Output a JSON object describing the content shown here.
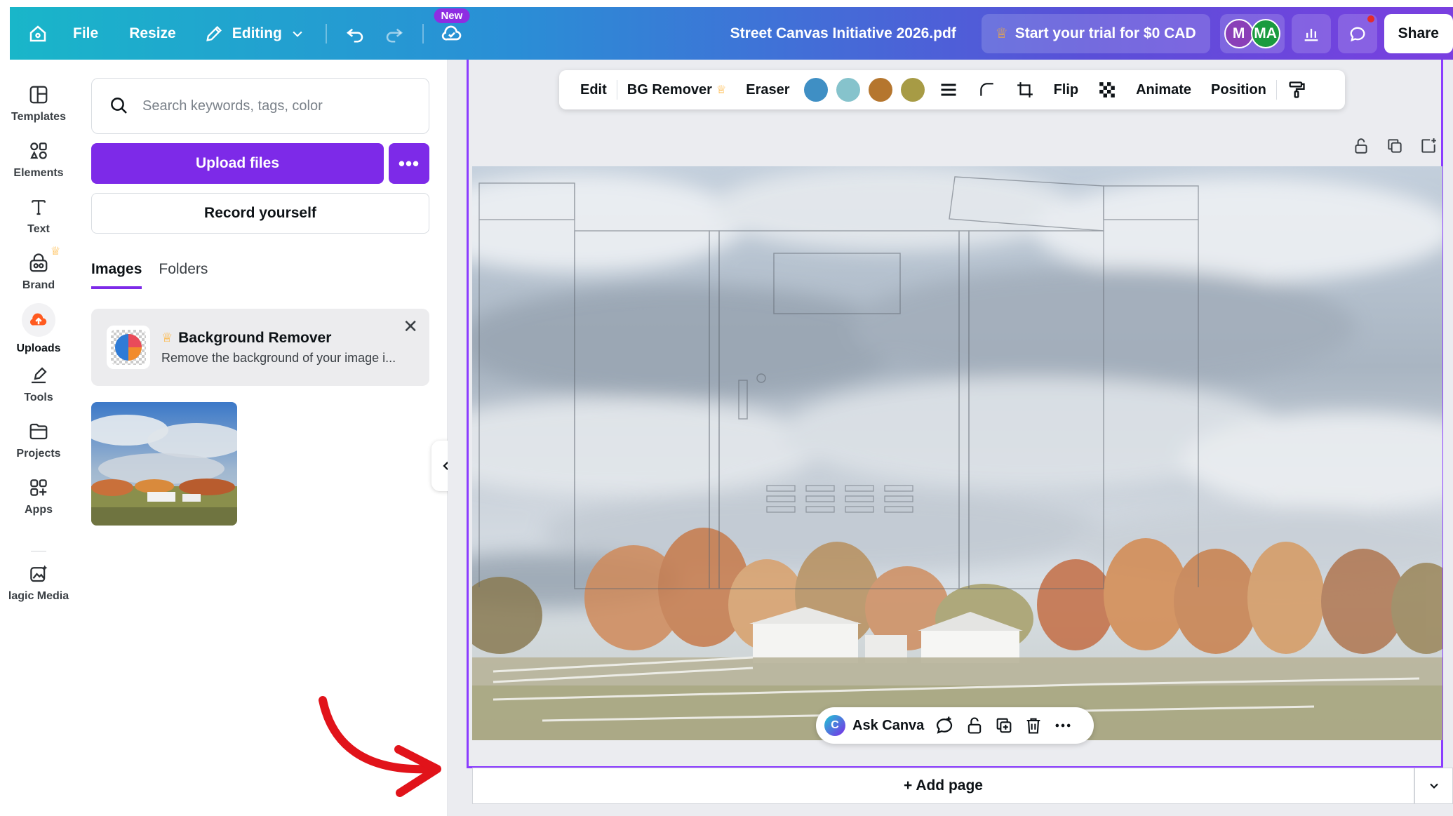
{
  "topbar": {
    "menu_file": "File",
    "menu_resize": "Resize",
    "editing_label": "Editing",
    "new_badge": "New",
    "document_title": "Street Canvas Initiative 2026.pdf",
    "trial_label": "Start your trial for $0 CAD",
    "avatars": [
      "M",
      "MA"
    ],
    "share_label": "Share",
    "accent_colors": {
      "gradient_start": "#19b6c9",
      "gradient_end": "#7a3fe0"
    }
  },
  "rail": {
    "items": [
      {
        "label": "Templates",
        "icon": "templates-icon"
      },
      {
        "label": "Elements",
        "icon": "elements-icon"
      },
      {
        "label": "Text",
        "icon": "text-icon"
      },
      {
        "label": "Brand",
        "icon": "brand-icon"
      },
      {
        "label": "Uploads",
        "icon": "cloud-upload-icon"
      },
      {
        "label": "Tools",
        "icon": "pen-tool-icon"
      },
      {
        "label": "Projects",
        "icon": "folder-icon"
      },
      {
        "label": "Apps",
        "icon": "apps-grid-icon"
      },
      {
        "label": "lagic Media",
        "icon": "magic-media-icon"
      }
    ],
    "active": "Uploads"
  },
  "panel": {
    "search_placeholder": "Search keywords, tags, color",
    "upload_label": "Upload files",
    "more_label": "•••",
    "record_label": "Record yourself",
    "tabs": [
      {
        "label": "Images",
        "active": true
      },
      {
        "label": "Folders",
        "active": false
      }
    ],
    "bg_remover": {
      "title": "Background Remover",
      "description": "Remove the background of your image i..."
    }
  },
  "context_toolbar": {
    "edit": "Edit",
    "bg_remover": "BG Remover",
    "eraser": "Eraser",
    "swatches": [
      "#3f8fc4",
      "#86c3cc",
      "#b5762e",
      "#a79b45"
    ],
    "flip": "Flip",
    "animate": "Animate",
    "position": "Position"
  },
  "floating_bar": {
    "ask_canva": "Ask Canva"
  },
  "add_page_label": "+ Add page"
}
